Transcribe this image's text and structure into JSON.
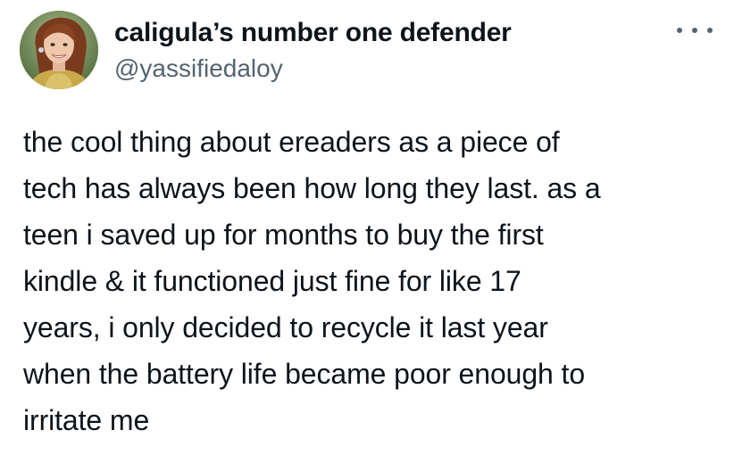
{
  "author": {
    "display_name": "caligula’s number one defender",
    "handle": "@yassifiedaloy",
    "avatar_icon": "profile-photo-avatar"
  },
  "menu": {
    "icon": "more-horizontal-icon"
  },
  "tweet": {
    "lines": [
      "the cool thing about ereaders as a piece of",
      "tech has always been how long they last. as a",
      "teen i saved up for months to buy the first",
      "kindle & it functioned just fine for like 17",
      "years, i only decided to recycle it last year",
      "when the battery life became poor enough to",
      "irritate me"
    ]
  },
  "colors": {
    "text_primary": "#0f1419",
    "text_secondary": "#536471",
    "background": "#ffffff"
  }
}
